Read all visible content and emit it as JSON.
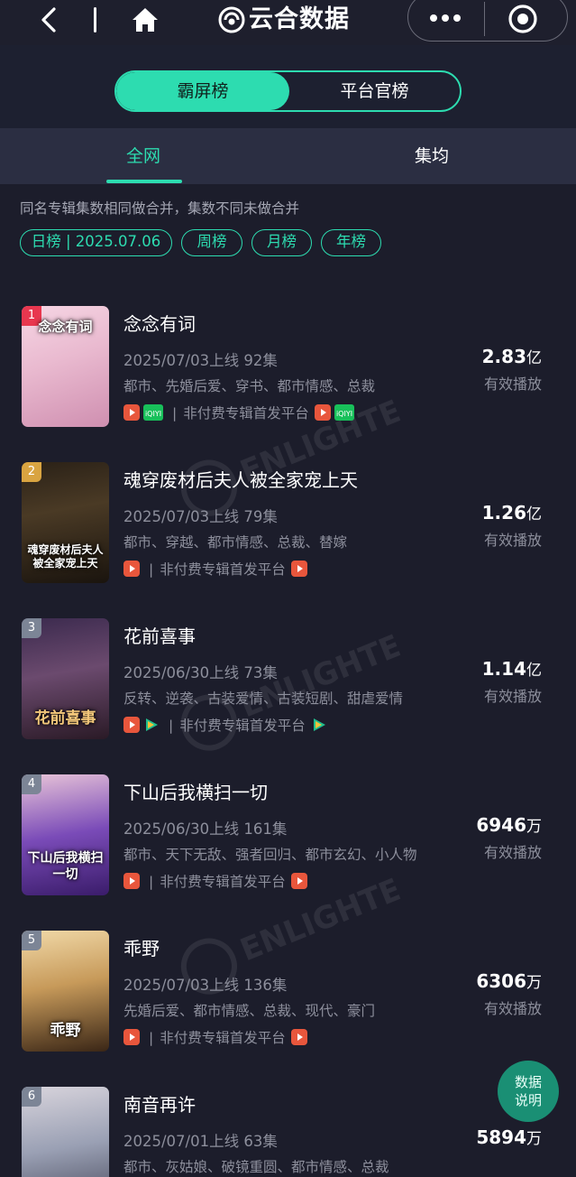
{
  "nav": {
    "title": "云合数据"
  },
  "header": {
    "tabs": [
      {
        "label": "霸屏榜",
        "active": true
      },
      {
        "label": "平台官榜",
        "active": false
      }
    ]
  },
  "subtabs": [
    {
      "label": "全网",
      "active": true
    },
    {
      "label": "集均",
      "active": false
    }
  ],
  "note": "同名专辑集数相同做合并，集数不同未做合并",
  "filters": [
    {
      "label": "日榜 | 2025.07.06",
      "active": true
    },
    {
      "label": "周榜",
      "active": false
    },
    {
      "label": "月榜",
      "active": false
    },
    {
      "label": "年榜",
      "active": false
    }
  ],
  "colors": {
    "accent": "#2ddcb0",
    "background": "#1c1d2b",
    "rank_1": "#e8374f",
    "rank_2": "#d9a441",
    "rank_other": "#7c8596",
    "youku": "#e8563c",
    "iqiyi": "#18c05a",
    "tencent": "#1fbf8e"
  },
  "list": [
    {
      "rank": "1",
      "title": "念念有词",
      "poster_text": "念念有词",
      "release": "2025/07/03上线 92集",
      "tags": "都市、先婚后爱、穿书、都市情感、总裁",
      "platforms_before": [
        "youku-icon",
        "iqiyi-icon"
      ],
      "platform_note": "非付费专辑首发平台",
      "platforms_after": [
        "youku-icon",
        "iqiyi-icon"
      ],
      "value": "2.83",
      "unit": "亿",
      "value_label": "有效播放"
    },
    {
      "rank": "2",
      "title": "魂穿废材后夫人被全家宠上天",
      "poster_text": "魂穿废材后夫人被全家宠上天",
      "release": "2025/07/03上线 79集",
      "tags": "都市、穿越、都市情感、总裁、替嫁",
      "platforms_before": [
        "youku-icon"
      ],
      "platform_note": "非付费专辑首发平台",
      "platforms_after": [
        "youku-icon"
      ],
      "value": "1.26",
      "unit": "亿",
      "value_label": "有效播放"
    },
    {
      "rank": "3",
      "title": "花前喜事",
      "poster_text": "花前喜事",
      "release": "2025/06/30上线 73集",
      "tags": "反转、逆袭、古装爱情、古装短剧、甜虐爱情",
      "platforms_before": [
        "youku-icon",
        "tencent-icon"
      ],
      "platform_note": "非付费专辑首发平台",
      "platforms_after": [
        "tencent-icon"
      ],
      "value": "1.14",
      "unit": "亿",
      "value_label": "有效播放"
    },
    {
      "rank": "4",
      "title": "下山后我横扫一切",
      "poster_text": "下山后我横扫一切",
      "release": "2025/06/30上线 161集",
      "tags": "都市、天下无敌、强者回归、都市玄幻、小人物",
      "platforms_before": [
        "youku-icon"
      ],
      "platform_note": "非付费专辑首发平台",
      "platforms_after": [
        "youku-icon"
      ],
      "value": "6946",
      "unit": "万",
      "value_label": "有效播放"
    },
    {
      "rank": "5",
      "title": "乖野",
      "poster_text": "乖野",
      "release": "2025/07/03上线 136集",
      "tags": "先婚后爱、都市情感、总裁、现代、豪门",
      "platforms_before": [
        "youku-icon"
      ],
      "platform_note": "非付费专辑首发平台",
      "platforms_after": [
        "youku-icon"
      ],
      "value": "6306",
      "unit": "万",
      "value_label": "有效播放"
    },
    {
      "rank": "6",
      "title": "南音再许",
      "poster_text": "",
      "release": "2025/07/01上线 63集",
      "tags": "都市、灰姑娘、破镜重圆、都市情感、总裁",
      "platforms_before": [],
      "platform_note": "",
      "platforms_after": [],
      "value": "5894",
      "unit": "万",
      "value_label": ""
    }
  ],
  "fab": {
    "line1": "数据",
    "line2": "说明"
  }
}
